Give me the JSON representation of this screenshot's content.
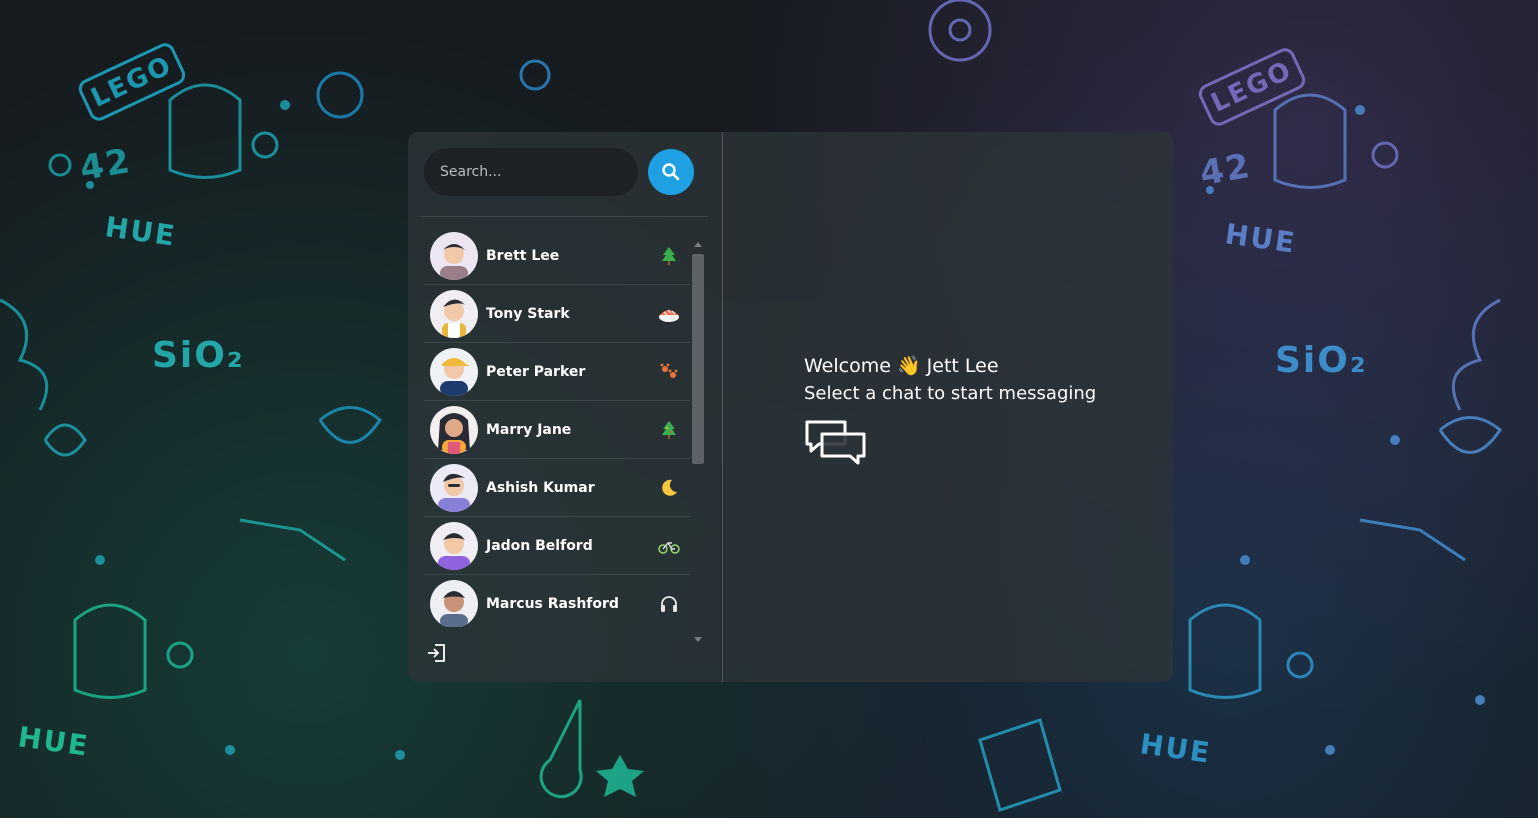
{
  "search": {
    "placeholder": "Search..."
  },
  "icons": {
    "search": "search-icon",
    "logout": "logout-icon",
    "chat": "chat-bubbles-icon"
  },
  "colors": {
    "accent": "#1ea0e2",
    "panel": "#2d3438",
    "text": "#ffffff"
  },
  "chats": [
    {
      "name": "Brett Lee",
      "emoji": "tree-emoji"
    },
    {
      "name": "Tony Stark",
      "emoji": "sushi-emoji"
    },
    {
      "name": "Peter Parker",
      "emoji": "paw-prints-emoji"
    },
    {
      "name": "Marry Jane",
      "emoji": "tree-emoji"
    },
    {
      "name": "Ashish Kumar",
      "emoji": "crescent-moon-emoji"
    },
    {
      "name": "Jadon Belford",
      "emoji": "bicycle-emoji"
    },
    {
      "name": "Marcus Rashford",
      "emoji": "headphones-emoji"
    }
  ],
  "welcome": {
    "greeting": "Welcome 👋 Jett Lee",
    "subtitle": "Select a chat to start messaging"
  }
}
